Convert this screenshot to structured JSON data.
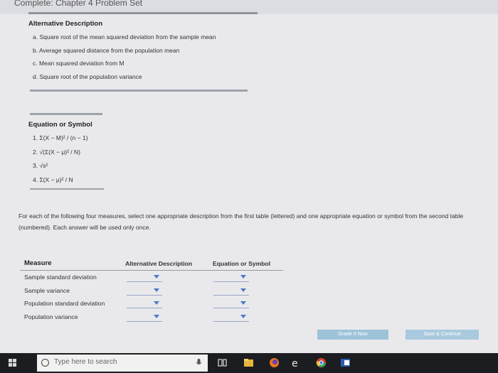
{
  "window": {
    "title": "Complete: Chapter 4 Problem Set"
  },
  "alt_table": {
    "header": "Alternative Description",
    "items": [
      "a. Square root of the mean squared deviation from the sample mean",
      "b. Average squared distance from the population mean",
      "c. Mean squared deviation from M",
      "d. Square root of the population variance"
    ]
  },
  "eq_table": {
    "header": "Equation or Symbol",
    "items": [
      "1. Σ(X − M)² / (n − 1)",
      "2. √(Σ(X − μ)² / N)",
      "3. √s²",
      "4. Σ(X − μ)² / N"
    ]
  },
  "instructions": "For each of the following four measures, select one appropriate description from the first table (lettered) and one appropriate equation or symbol from the second table (numbered). Each answer will be used only once.",
  "answer_table": {
    "col_measure": "Measure",
    "col_alt": "Alternative Description",
    "col_eq": "Equation or Symbol",
    "rows": [
      "Sample standard deviation",
      "Sample variance",
      "Population standard deviation",
      "Population variance"
    ]
  },
  "buttons": {
    "grade": "Grade It Now",
    "save": "Save & Continue"
  },
  "taskbar": {
    "search_placeholder": "Type here to search"
  }
}
